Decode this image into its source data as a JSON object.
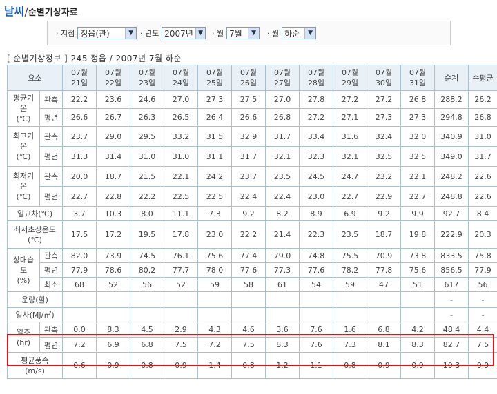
{
  "header": {
    "title": "날씨",
    "separator": "/",
    "subtitle": "순별기상자료"
  },
  "filters": [
    {
      "label": "· 지점",
      "value": "정읍(관)"
    },
    {
      "label": "· 년도",
      "value": "2007년"
    },
    {
      "label": "· 월",
      "value": "7월"
    },
    {
      "label": "· 월",
      "value": "하순"
    }
  ],
  "info": {
    "text": "[ 순별기상정보 ] 245 정읍 / 2007년 7월 하순"
  },
  "table": {
    "corner": "요소",
    "dates": [
      "07월\n21일",
      "07월\n22일",
      "07월\n23일",
      "07월\n24일",
      "07월\n25일",
      "07월\n26일",
      "07월\n27일",
      "07월\n28일",
      "07월\n29일",
      "07월\n30일",
      "07월\n31일"
    ],
    "sum_label": "순계",
    "avg_label": "순평균",
    "groups": [
      {
        "name": "평균기\n온\n(℃)",
        "rows": [
          {
            "sub": "관측",
            "values": [
              "22.2",
              "23.6",
              "24.6",
              "27.0",
              "27.3",
              "27.5",
              "27.0",
              "27.8",
              "27.2",
              "27.2",
              "26.8",
              "288.2",
              "26.2"
            ]
          },
          {
            "sub": "평년",
            "values": [
              "26.6",
              "26.7",
              "26.3",
              "26.5",
              "26.4",
              "26.6",
              "26.8",
              "27.2",
              "27.1",
              "27.3",
              "27.3",
              "294.8",
              "26.8"
            ]
          }
        ]
      },
      {
        "name": "최고기\n온\n(℃)",
        "rows": [
          {
            "sub": "관측",
            "values": [
              "23.7",
              "29.0",
              "29.5",
              "33.2",
              "31.5",
              "32.9",
              "31.7",
              "33.4",
              "31.6",
              "32.4",
              "32.0",
              "340.9",
              "31.0"
            ]
          },
          {
            "sub": "평년",
            "values": [
              "31.3",
              "31.4",
              "31.0",
              "31.0",
              "31.1",
              "31.7",
              "32.1",
              "32.3",
              "32.1",
              "32.5",
              "32.5",
              "349.0",
              "31.7"
            ]
          }
        ]
      },
      {
        "name": "최저기\n온\n(℃)",
        "rows": [
          {
            "sub": "관측",
            "values": [
              "20.0",
              "18.7",
              "21.5",
              "22.1",
              "24.2",
              "23.7",
              "23.5",
              "24.5",
              "24.7",
              "23.2",
              "22.1",
              "248.2",
              "22.6"
            ]
          },
          {
            "sub": "평년",
            "values": [
              "22.7",
              "22.8",
              "22.2",
              "22.5",
              "22.5",
              "22.4",
              "22.4",
              "23.0",
              "22.7",
              "22.9",
              "22.7",
              "248.8",
              "22.6"
            ]
          }
        ]
      },
      {
        "name": "일교차(℃)",
        "rows": [
          {
            "sub": "",
            "values": [
              "3.7",
              "10.3",
              "8.0",
              "11.1",
              "7.3",
              "9.2",
              "8.2",
              "8.9",
              "6.9",
              "9.2",
              "9.9",
              "92.7",
              "8.4"
            ]
          }
        ]
      },
      {
        "name": "최저초상온도\n(℃)",
        "rows": [
          {
            "sub": "",
            "values": [
              "17.5",
              "17.2",
              "19.5",
              "17.8",
              "23.0",
              "22.2",
              "21.4",
              "22.3",
              "23.5",
              "18.7",
              "19.8",
              "222.9",
              "20.3"
            ]
          }
        ]
      },
      {
        "name": "상대습\n도\n(%)",
        "rows": [
          {
            "sub": "관측",
            "values": [
              "82.0",
              "73.9",
              "74.5",
              "76.1",
              "75.6",
              "77.4",
              "79.0",
              "74.8",
              "75.5",
              "70.9",
              "73.8",
              "833.5",
              "75.8"
            ]
          },
          {
            "sub": "평년",
            "values": [
              "77.9",
              "78.6",
              "80.2",
              "77.7",
              "78.0",
              "77.6",
              "77.3",
              "77.6",
              "78.2",
              "77.8",
              "75.6",
              "856.5",
              "77.9"
            ]
          },
          {
            "sub": "최소",
            "values": [
              "68",
              "52",
              "56",
              "52",
              "59",
              "58",
              "61",
              "54",
              "59",
              "47",
              "51",
              "617",
              "56"
            ]
          }
        ]
      },
      {
        "name": "운량(할)",
        "rows": [
          {
            "sub": "",
            "values": [
              "",
              "",
              "",
              "",
              "",
              "",
              "",
              "",
              "",
              "",
              "",
              "-",
              "-"
            ]
          }
        ]
      },
      {
        "name": "일사(MJ/㎡)",
        "rows": [
          {
            "sub": "",
            "values": [
              "",
              "",
              "",
              "",
              "",
              "",
              "",
              "",
              "",
              "",
              "",
              "-",
              "-"
            ]
          }
        ]
      },
      {
        "name": "일조\n(hr)",
        "rows": [
          {
            "sub": "관측",
            "values": [
              "0.0",
              "8.3",
              "4.5",
              "2.9",
              "4.3",
              "4.6",
              "3.6",
              "7.6",
              "1.6",
              "6.8",
              "4.2",
              "48.4",
              "4.4"
            ]
          },
          {
            "sub": "평년",
            "values": [
              "7.2",
              "6.9",
              "6.8",
              "7.5",
              "7.2",
              "7.5",
              "8.3",
              "7.6",
              "7.3",
              "8.1",
              "8.3",
              "82.7",
              "7.5"
            ]
          }
        ]
      },
      {
        "name": "평균풍속\n(m/s)",
        "rows": [
          {
            "sub": "",
            "values": [
              "0.6",
              "0.9",
              "0.8",
              "0.9",
              "1.4",
              "0.8",
              "1.2",
              "1.1",
              "0.8",
              "0.9",
              "0.9",
              "10.3",
              "0.9"
            ]
          }
        ]
      }
    ]
  },
  "highlight": {
    "color": "#d7161c",
    "group": "일조\n(hr)"
  }
}
